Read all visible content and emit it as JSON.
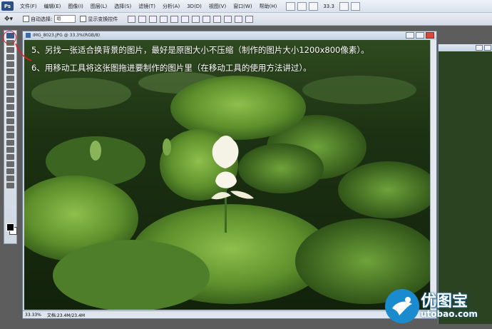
{
  "app": {
    "logo": "Ps"
  },
  "menubar": {
    "items": [
      "文件(F)",
      "编辑(E)",
      "图像(I)",
      "图层(L)",
      "选择(S)",
      "滤镜(T)",
      "分析(A)",
      "3D(D)",
      "视图(V)",
      "窗口(W)",
      "帮助(H)"
    ],
    "zoom": "33.3"
  },
  "options": {
    "auto_select_label": "自动选择:",
    "auto_select_value": "组",
    "transform_label": "显示变换控件"
  },
  "document": {
    "title": "IMG_8023.JPG @ 33.3%(RGB/8)",
    "status_zoom": "33.33%",
    "status_doc": "文档:23.4M/23.4M"
  },
  "instructions": {
    "line5": "5、另找一张适合换背景的图片，最好是原图大小不压缩（制作的图片大小1200x800像素）。",
    "line6": "6、用移动工具将这张图拖进要制作的图片里（在移动工具的使用方法讲过）。"
  },
  "watermark": {
    "name": "优图宝",
    "url": "utobao.com"
  },
  "colors": {
    "foreground": "#000000",
    "background": "#ffffff",
    "annotation": "#e81c1c",
    "watermark": "#1b8bd0"
  },
  "icons": [
    "move-tool-icon",
    "marquee-tool-icon",
    "lasso-tool-icon",
    "crop-tool-icon",
    "brush-tool-icon",
    "eraser-tool-icon",
    "type-tool-icon",
    "pen-tool-icon",
    "hand-tool-icon",
    "zoom-tool-icon"
  ]
}
